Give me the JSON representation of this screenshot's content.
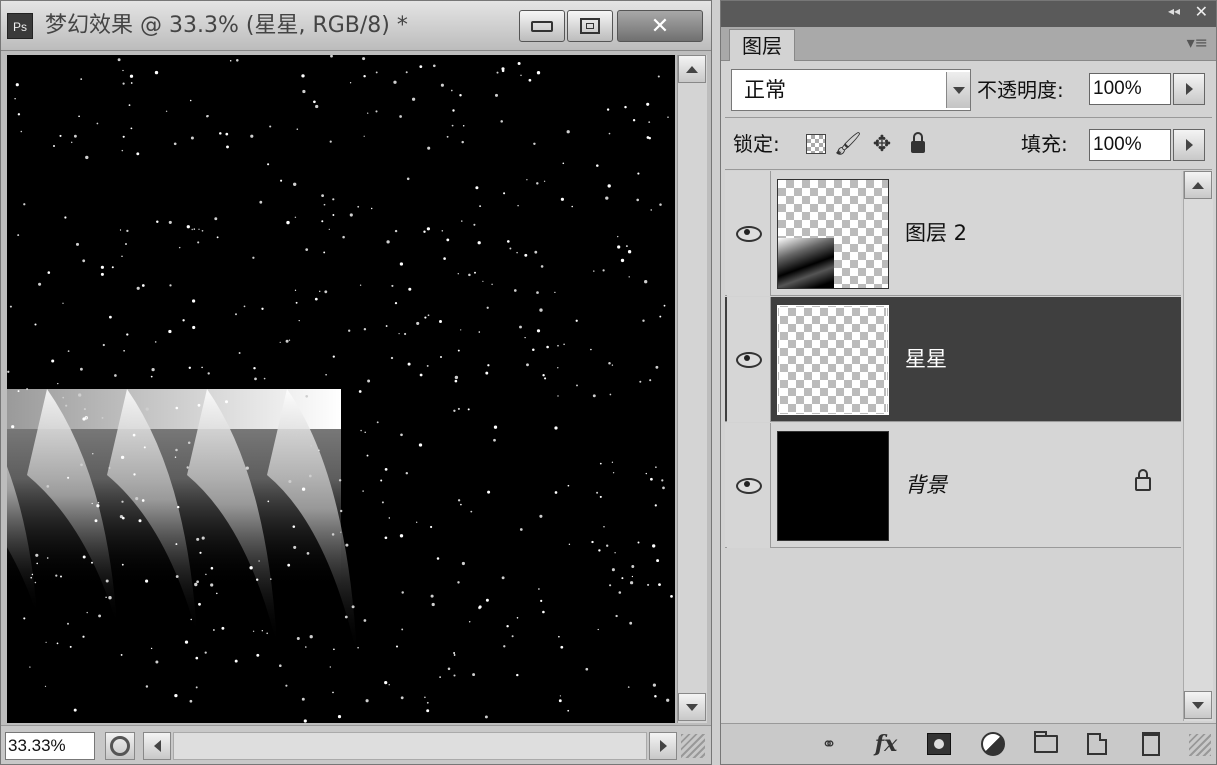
{
  "document": {
    "app_icon": "Ps",
    "title": "梦幻效果 @ 33.3% (星星, RGB/8) *",
    "zoom": "33.33%"
  },
  "panel": {
    "collapse_glyph": "◂◂",
    "close_glyph": "✕",
    "tab_label": "图层",
    "menu_glyph": "▾≡",
    "blend_mode": "正常",
    "opacity_label": "不透明度:",
    "opacity_value": "100%",
    "lock_label": "锁定:",
    "fill_label": "填充:",
    "fill_value": "100%",
    "layers": [
      {
        "name": "图层 2",
        "visible": true,
        "selected": false,
        "thumbnail": "transparent-with-streaks"
      },
      {
        "name": "星星",
        "visible": true,
        "selected": true,
        "thumbnail": "transparent"
      },
      {
        "name": "背景",
        "visible": true,
        "selected": false,
        "locked": true,
        "thumbnail": "black"
      }
    ],
    "bottom_icons": [
      "link-icon",
      "fx-icon",
      "mask-icon",
      "adjustment-icon",
      "group-folder-icon",
      "new-layer-icon",
      "trash-icon"
    ],
    "fx_label": "fx",
    "link_glyph": "⚭",
    "paint_glyph": "🖌",
    "move_glyph": "✥"
  },
  "colors": {
    "canvas_bg": "#000000",
    "selected_row": "#3f3f3f"
  }
}
